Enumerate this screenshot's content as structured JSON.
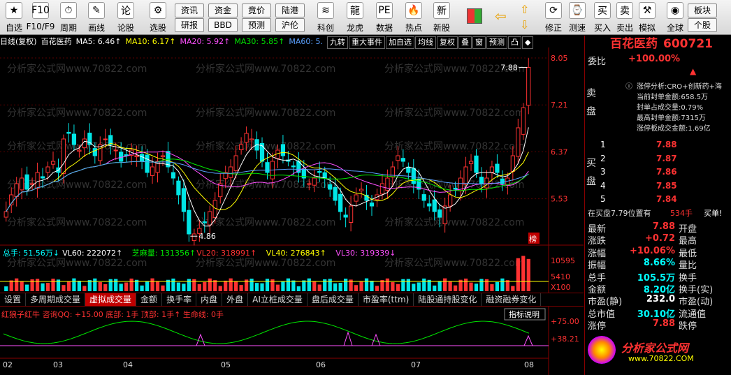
{
  "toolbar": {
    "buttons": [
      {
        "label": "自选",
        "icon": "watchlist-icon"
      },
      {
        "label": "F10/F9",
        "icon": "f10-icon"
      },
      {
        "label": "周期",
        "icon": "clock-icon"
      },
      {
        "label": "画线",
        "icon": "pencil-icon"
      },
      {
        "label": "论股",
        "icon": "forum-icon"
      },
      {
        "label": "选股",
        "icon": "filter-icon"
      },
      {
        "label": "科创",
        "icon": "kechuang-icon"
      },
      {
        "label": "龙虎",
        "icon": "dragon-icon"
      },
      {
        "label": "数据",
        "icon": "pe-icon"
      },
      {
        "label": "热点",
        "icon": "hot-icon"
      },
      {
        "label": "新股",
        "icon": "ipo-icon"
      },
      {
        "label": "修正",
        "icon": "fix-icon"
      },
      {
        "label": "测速",
        "icon": "stopwatch-icon"
      },
      {
        "label": "买入",
        "icon": "buy-icon"
      },
      {
        "label": "卖出",
        "icon": "sell-icon"
      },
      {
        "label": "模拟",
        "icon": "gavel-icon"
      },
      {
        "label": "全球",
        "icon": "globe-icon"
      }
    ],
    "small_buttons": [
      "资讯",
      "研报",
      "资金",
      "BBD",
      "竟价",
      "预测",
      "陆港",
      "沪伦",
      "板块",
      "个股"
    ]
  },
  "chart": {
    "header": "日线(复权)",
    "stock_name": "百花医药",
    "ma": [
      {
        "label": "MA5: 6.46↑",
        "color": "#ffffff"
      },
      {
        "label": "MA10: 6.17↑",
        "color": "#ffff00"
      },
      {
        "label": "MA20: 5.92↑",
        "color": "#ff50ff"
      },
      {
        "label": "MA30: 5.85↑",
        "color": "#00e600"
      },
      {
        "label": "MA60: 5.",
        "color": "#5aa0ff"
      }
    ],
    "tool_buttons": [
      "九转",
      "重大事件",
      "加自选",
      "均线",
      "复权",
      "叠",
      "窗",
      "预测",
      "凸",
      "◆"
    ],
    "price_axis": [
      "8.05",
      "7.21",
      "6.37",
      "5.53"
    ],
    "high_label": "7.88",
    "low_label": "4.86",
    "bang_label": "榜",
    "vol_header": [
      {
        "t": "总手: 51.56万↓",
        "c": "#00ffff"
      },
      {
        "t": "VL60: 222072↑",
        "c": "#ffffff"
      },
      {
        "t": "芝麻量: 131356↑",
        "c": "#00e600"
      },
      {
        "t": "VL20: 318991↑",
        "c": "#ff3232"
      },
      {
        "t": "VL40: 276843↑",
        "c": "#ffff00"
      },
      {
        "t": "VL30: 319339↓",
        "c": "#ff50ff"
      }
    ],
    "vol_axis": [
      "10595",
      "5410",
      "X100"
    ],
    "tabs": [
      "设置",
      "多周期成交量",
      "虚拟成交量",
      "金额",
      "换手率",
      "内盘",
      "外盘",
      "AI立桩成交量",
      "盘后成交量",
      "市盈率(ttm)",
      "陆股通持股变化",
      "融资融券变化"
    ],
    "active_tab": "虚拟成交量",
    "ind_header": "红狼子红牛 咨询QQ: +15.00 底部: 1手 顶部: 1手↑ 生命线: 0手",
    "ind_help": "指标说明",
    "ind_axis": [
      "+75.00",
      "+38.21"
    ],
    "months": [
      "02",
      "03",
      "04",
      "05",
      "06",
      "07",
      "08"
    ],
    "watermark": "分析家公式网www.70822.com"
  },
  "chart_data": {
    "type": "candlestick",
    "title": "百花医药 600721",
    "y_range": [
      4.7,
      8.2
    ],
    "closes": [
      5.3,
      5.6,
      5.8,
      5.9,
      5.7,
      5.8,
      6.0,
      5.9,
      6.1,
      6.2,
      6.0,
      6.6,
      6.7,
      6.5,
      6.4,
      6.6,
      6.5,
      6.3,
      6.5,
      6.6,
      6.5,
      6.4,
      6.2,
      6.3,
      6.4,
      6.3,
      6.2,
      6.0,
      6.1,
      6.2,
      6.3,
      6.1,
      5.9,
      5.6,
      5.3,
      4.9,
      4.9,
      5.0,
      5.1,
      5.3,
      5.5,
      5.8,
      6.0,
      6.1,
      6.3,
      6.5,
      6.7,
      6.6,
      6.4,
      6.2,
      6.0,
      6.2,
      6.4,
      6.3,
      6.2,
      6.1,
      6.0,
      5.9,
      5.8,
      5.9,
      6.0,
      5.9,
      5.7,
      5.5,
      5.3,
      5.2,
      5.4,
      5.6,
      5.7,
      5.5,
      5.4,
      5.6,
      5.8,
      5.9,
      6.1,
      6.3,
      6.2,
      6.0,
      5.8,
      5.7,
      5.5,
      5.4,
      5.3,
      5.2,
      5.4,
      5.6,
      5.7,
      5.9,
      6.1,
      6.2,
      6.0,
      5.8,
      5.9,
      6.1,
      6.0,
      5.8,
      5.9,
      6.3,
      6.8,
      7.16,
      7.88
    ],
    "ma_labels": [
      "MA5: 6.46",
      "MA10: 6.17",
      "MA20: 5.92",
      "MA30: 5.85"
    ],
    "high": 7.88,
    "low": 4.86,
    "volume_axis": [
      10595,
      5410
    ],
    "indicator": {
      "name": "红狼子红牛",
      "bottom": 1,
      "top": 1,
      "axis": [
        75.0,
        38.21
      ]
    }
  },
  "side": {
    "title": "百花医药",
    "code": "600721",
    "weibi_label": "委比",
    "weibi_value": "+100.00%",
    "sell_label": "卖盘",
    "buy_label": "买盘",
    "zt_lines": [
      "涨停分析:CRO+创新药+海",
      "当前封单金额:658.5万",
      "封单占成交量:0.79%",
      "最高封单金额:7315万",
      "涨停板成交金额:1.69亿"
    ],
    "bids": [
      {
        "n": "1",
        "p": "7.88"
      },
      {
        "n": "2",
        "p": "7.87"
      },
      {
        "n": "3",
        "p": "7.86"
      },
      {
        "n": "4",
        "p": "7.85"
      },
      {
        "n": "5",
        "p": "7.84"
      }
    ],
    "queue_text": "在买盘7.79位置有",
    "queue_vol": "534手",
    "queue_tag": "买单!",
    "stats": [
      {
        "l": "最新",
        "v": "7.88",
        "vc": "#ff3232",
        "r": "开盘"
      },
      {
        "l": "涨跌",
        "v": "+0.72",
        "vc": "#ff3232",
        "r": "最高"
      },
      {
        "l": "涨幅",
        "v": "+10.06%",
        "vc": "#ff3232",
        "r": "最低"
      },
      {
        "l": "振幅",
        "v": "8.66%",
        "vc": "#00ffff",
        "r": "量比"
      },
      {
        "l": "总手",
        "v": "105.5万",
        "vc": "#00ffff",
        "r": "换手"
      },
      {
        "l": "金额",
        "v": "8.20亿",
        "vc": "#00ffff",
        "r": "换手(实)"
      },
      {
        "l": "市盈(静)",
        "v": "232.0",
        "vc": "#ffffff",
        "r": "市盈(动)"
      },
      {
        "l": "总市值",
        "v": "30.10亿",
        "vc": "#00ffff",
        "r": "流通值"
      },
      {
        "l": "涨停",
        "v": "7.88",
        "vc": "#ff3232",
        "r": "跌停"
      }
    ],
    "logo_text": "分析家公式网",
    "logo_url": "www.70822.COM"
  }
}
